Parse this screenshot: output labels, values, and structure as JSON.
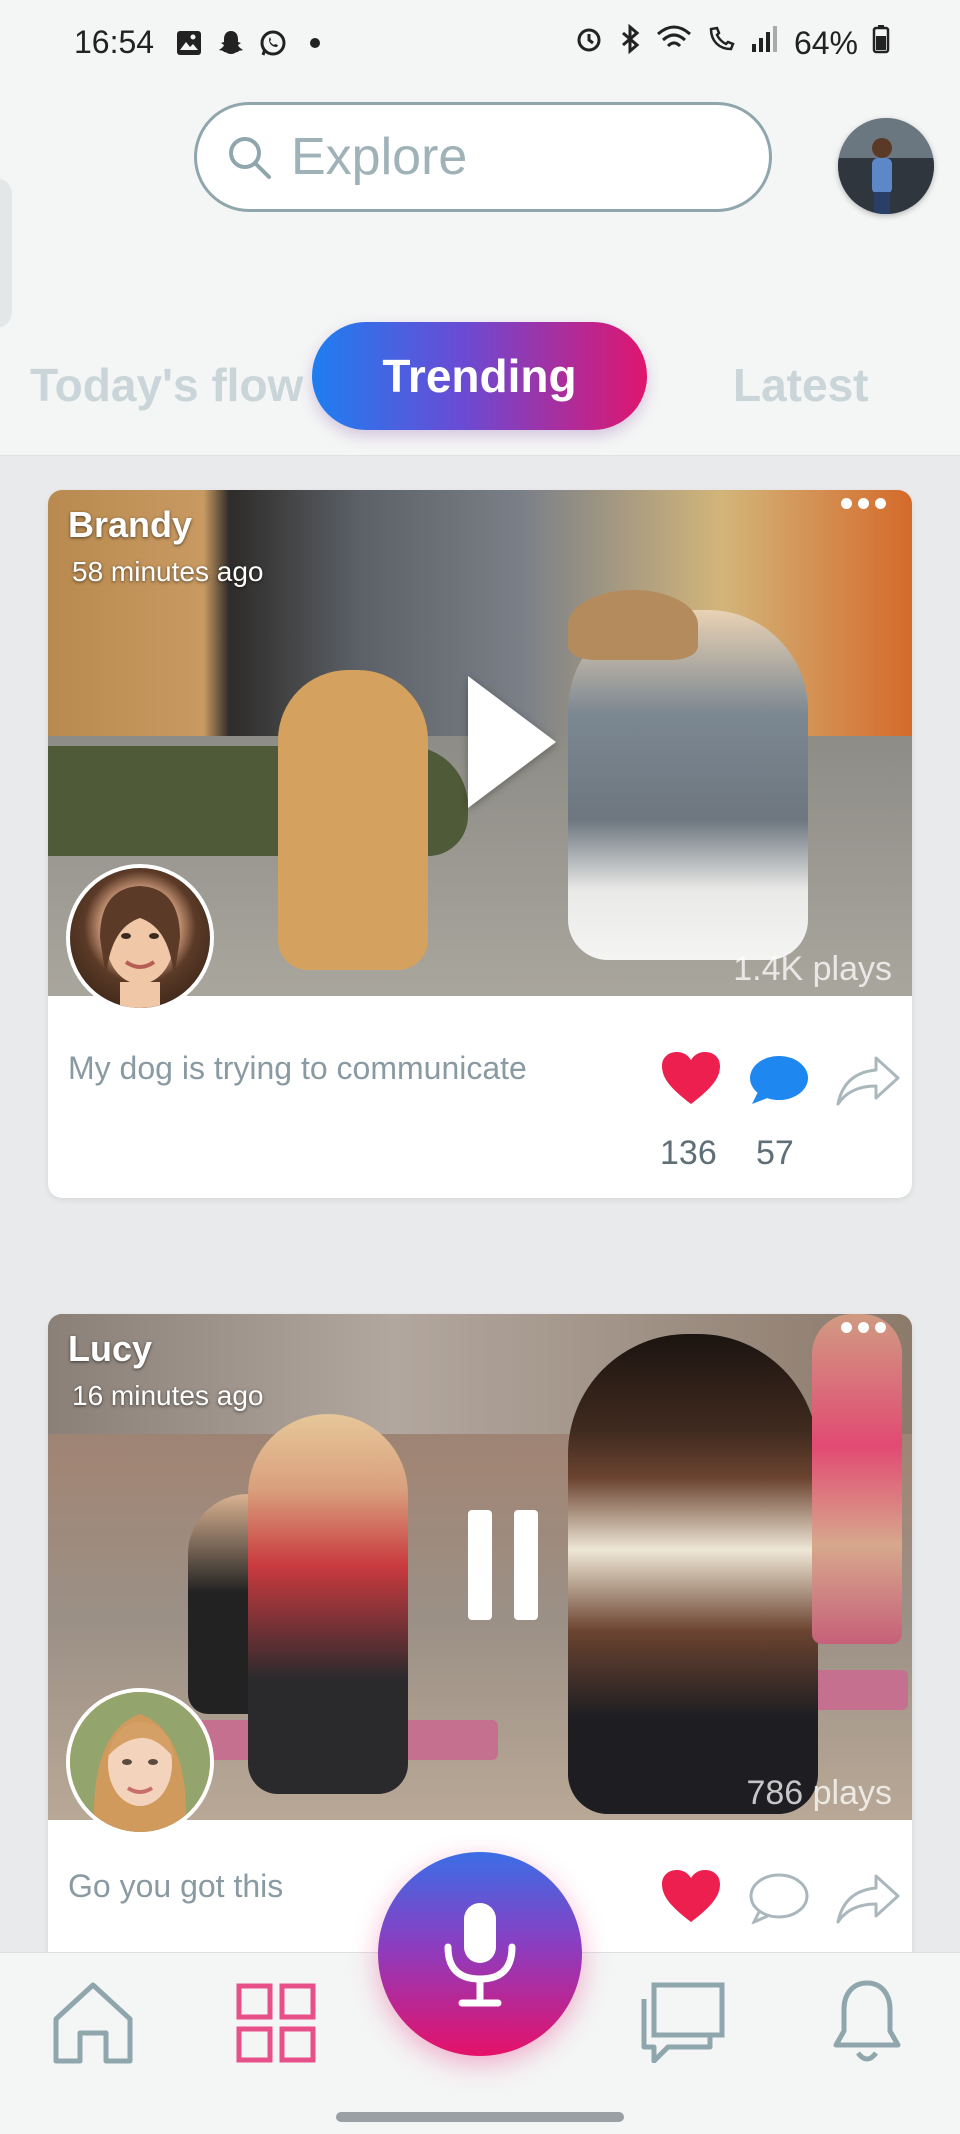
{
  "status_bar": {
    "time": "16:54",
    "battery": "64%",
    "left_icons": [
      "gallery-icon",
      "snapchat-icon",
      "whatsapp-icon",
      "dot-icon"
    ],
    "right_icons": [
      "alarm-icon",
      "bluetooth-icon",
      "wifi-icon",
      "wifi-call-icon",
      "signal-icon",
      "battery-icon"
    ]
  },
  "header": {
    "search_placeholder": "Explore",
    "profile_avatar": "profile-avatar"
  },
  "tabs": [
    {
      "label": "Today's flow",
      "active": false
    },
    {
      "label": "Trending",
      "active": true
    },
    {
      "label": "Latest",
      "active": false
    }
  ],
  "posts": [
    {
      "user": "Brandy",
      "time": "58 minutes ago",
      "plays": "1.4K plays",
      "caption": "My dog is trying to communicate",
      "likes": "136",
      "comments": "57",
      "state": "paused",
      "liked": true,
      "commented": true
    },
    {
      "user": "Lucy",
      "time": "16 minutes ago",
      "plays": "786 plays",
      "caption": "Go you got this",
      "likes": "",
      "comments": "",
      "state": "playing",
      "liked": true,
      "commented": false
    }
  ],
  "bottom_nav": {
    "items": [
      "home-icon",
      "grid-icon",
      "mic-icon",
      "chat-icon",
      "bell-icon"
    ],
    "active": "grid-icon"
  },
  "colors": {
    "accent_blue": "#1e7ef0",
    "accent_pink": "#e0156e",
    "heart_red": "#ec1f4f",
    "comment_blue": "#1e88f0",
    "muted_text": "#8a9aa2"
  }
}
